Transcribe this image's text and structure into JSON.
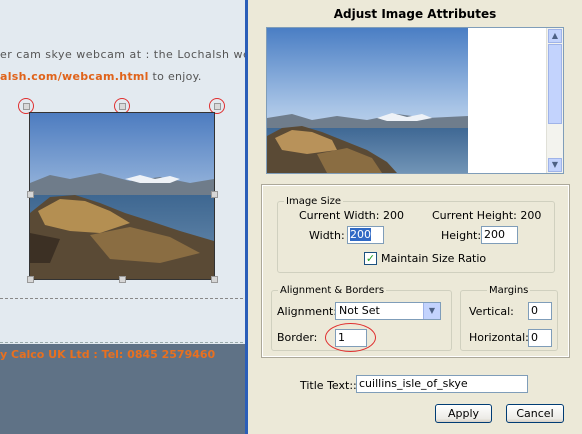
{
  "editor": {
    "line1": "er cam skye webcam at : the Lochalsh we",
    "line2_link": "alsh.com/webcam.html",
    "line2_rest": " to enjoy.",
    "footer_text": "y Calco UK Ltd : Tel: 0845 2579460",
    "colors": {
      "link": "#e0631a",
      "footer_band": "#5f7286",
      "handle_highlight": "#e03030"
    }
  },
  "dialog": {
    "title": "Adjust Image Attributes",
    "image_size": {
      "legend": "Image Size",
      "current_width_label": "Current Width: 200",
      "current_height_label": "Current Height: 200",
      "width_label": "Width:",
      "width_value": "200",
      "height_label": "Height:",
      "height_value": "200",
      "maintain_label": "Maintain Size Ratio",
      "maintain_checked": true
    },
    "alignment": {
      "legend": "Alignment & Borders",
      "alignment_label": "Alignment:",
      "alignment_value": "Not Set",
      "border_label": "Border:",
      "border_value": "1"
    },
    "margins": {
      "legend": "Margins",
      "vertical_label": "Vertical:",
      "vertical_value": "0",
      "horizontal_label": "Horizontal:",
      "horizontal_value": "0"
    },
    "title_text_label": "Title Text::",
    "title_text_value": "cuillins_isle_of_skye",
    "apply_label": "Apply",
    "cancel_label": "Cancel",
    "icons": {
      "scroll_up": "chevron-up-icon",
      "scroll_down": "chevron-down-icon",
      "dropdown": "chevron-down-icon",
      "checkbox": "checkmark-icon"
    }
  }
}
